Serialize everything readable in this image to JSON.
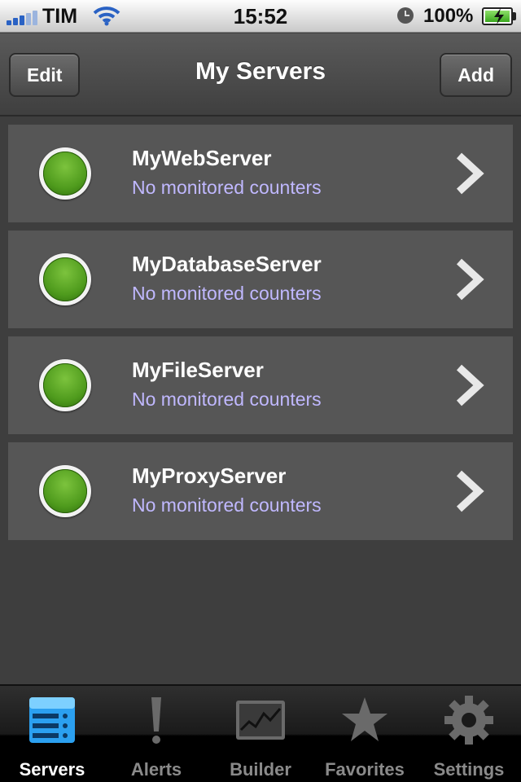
{
  "status_bar": {
    "carrier": "TIM",
    "time": "15:52",
    "battery_percent": "100%"
  },
  "nav": {
    "title": "My Servers",
    "edit_label": "Edit",
    "add_label": "Add"
  },
  "servers": [
    {
      "name": "MyWebServer",
      "subtitle": "No monitored counters",
      "status_color": "#4f9b1d"
    },
    {
      "name": "MyDatabaseServer",
      "subtitle": "No monitored counters",
      "status_color": "#4f9b1d"
    },
    {
      "name": "MyFileServer",
      "subtitle": "No monitored counters",
      "status_color": "#4f9b1d"
    },
    {
      "name": "MyProxyServer",
      "subtitle": "No monitored counters",
      "status_color": "#4f9b1d"
    }
  ],
  "tabs": [
    {
      "label": "Servers",
      "icon": "servers-icon",
      "active": true
    },
    {
      "label": "Alerts",
      "icon": "alert-icon",
      "active": false
    },
    {
      "label": "Builder",
      "icon": "chart-icon",
      "active": false
    },
    {
      "label": "Favorites",
      "icon": "star-icon",
      "active": false
    },
    {
      "label": "Settings",
      "icon": "gear-icon",
      "active": false
    }
  ],
  "colors": {
    "accent_blue": "#2ba0f0",
    "subtitle": "#c0b8ff",
    "status_ok": "#4f9b1d"
  }
}
